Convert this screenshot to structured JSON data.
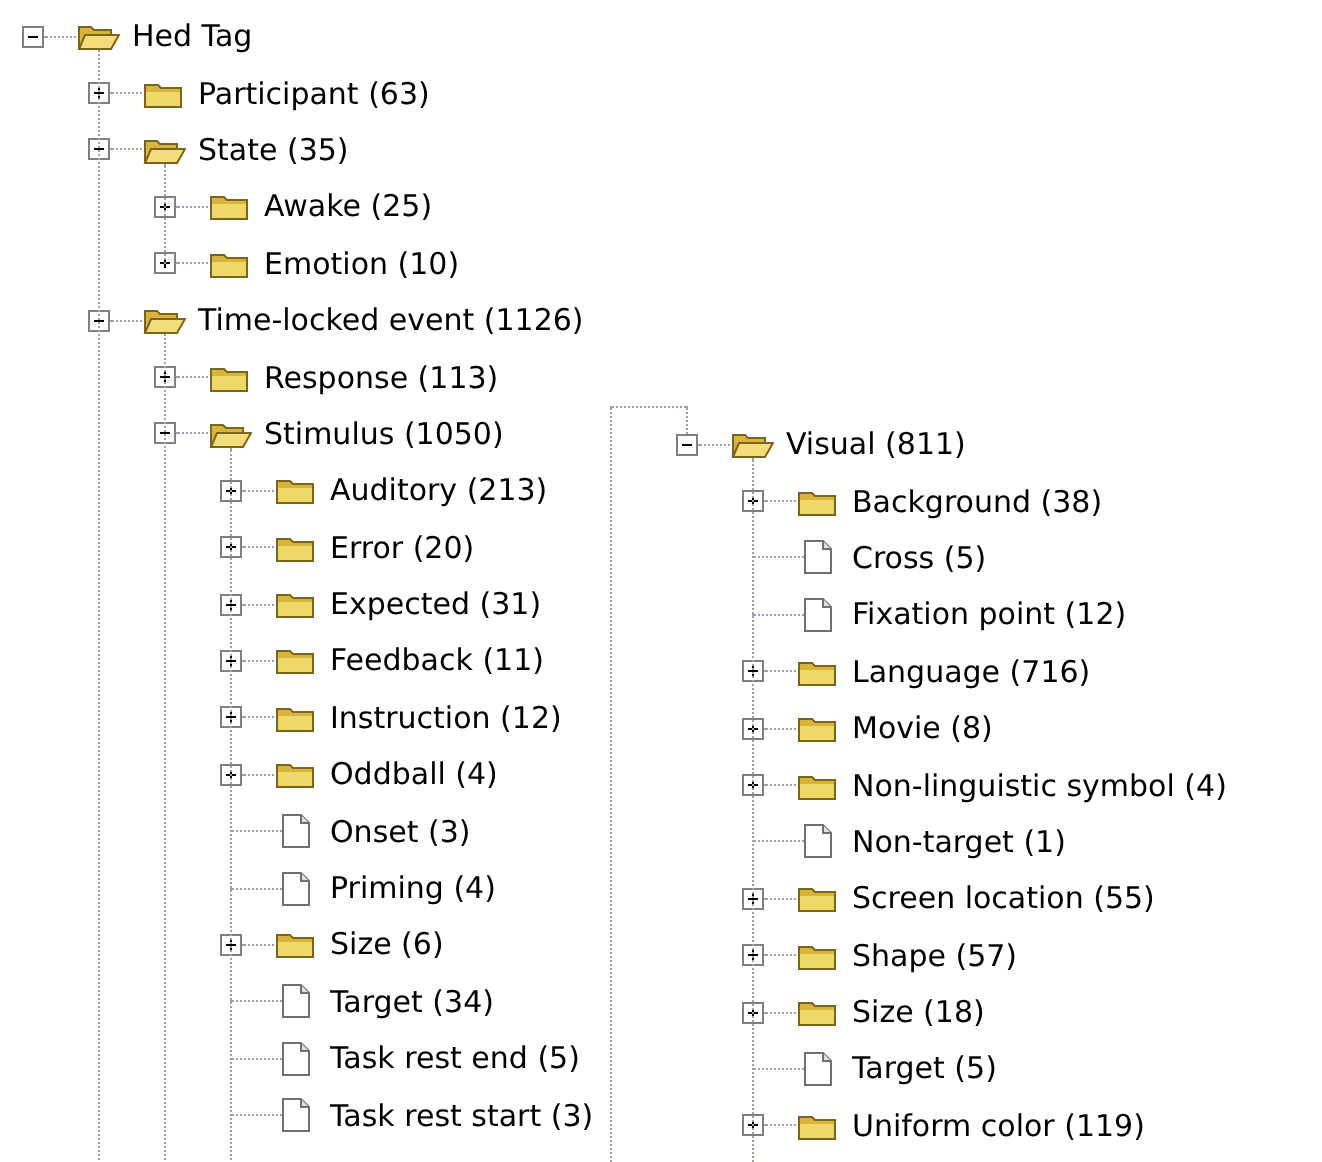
{
  "tree": {
    "label": "Hed Tag",
    "kind": "folder",
    "expanded": true,
    "children": [
      {
        "label": "Participant (63)",
        "kind": "folder",
        "expanded": false
      },
      {
        "label": "State (35)",
        "kind": "folder",
        "expanded": true,
        "children": [
          {
            "label": "Awake (25)",
            "kind": "folder",
            "expanded": false
          },
          {
            "label": "Emotion (10)",
            "kind": "folder",
            "expanded": false
          }
        ]
      },
      {
        "label": "Time-locked event (1126)",
        "kind": "folder",
        "expanded": true,
        "children": [
          {
            "label": "Response (113)",
            "kind": "folder",
            "expanded": false
          },
          {
            "label": "Stimulus (1050)",
            "kind": "folder",
            "expanded": true,
            "children": [
              {
                "label": "Auditory (213)",
                "kind": "folder",
                "expanded": false
              },
              {
                "label": "Error (20)",
                "kind": "folder",
                "expanded": false
              },
              {
                "label": "Expected (31)",
                "kind": "folder",
                "expanded": false
              },
              {
                "label": "Feedback (11)",
                "kind": "folder",
                "expanded": false
              },
              {
                "label": "Instruction (12)",
                "kind": "folder",
                "expanded": false
              },
              {
                "label": "Oddball (4)",
                "kind": "folder",
                "expanded": false
              },
              {
                "label": "Onset (3)",
                "kind": "leaf"
              },
              {
                "label": "Priming (4)",
                "kind": "leaf"
              },
              {
                "label": "Size (6)",
                "kind": "folder",
                "expanded": false
              },
              {
                "label": "Target (34)",
                "kind": "leaf"
              },
              {
                "label": "Task rest end (5)",
                "kind": "leaf"
              },
              {
                "label": "Task rest start (3)",
                "kind": "leaf"
              }
            ]
          }
        ]
      }
    ]
  },
  "continuation": {
    "label": "Visual (811)",
    "kind": "folder",
    "expanded": true,
    "children": [
      {
        "label": "Background (38)",
        "kind": "folder",
        "expanded": false
      },
      {
        "label": "Cross (5)",
        "kind": "leaf"
      },
      {
        "label": "Fixation point (12)",
        "kind": "leaf"
      },
      {
        "label": "Language (716)",
        "kind": "folder",
        "expanded": false
      },
      {
        "label": "Movie (8)",
        "kind": "folder",
        "expanded": false
      },
      {
        "label": "Non-linguistic symbol (4)",
        "kind": "folder",
        "expanded": false
      },
      {
        "label": "Non-target (1)",
        "kind": "leaf"
      },
      {
        "label": "Screen location (55)",
        "kind": "folder",
        "expanded": false
      },
      {
        "label": "Shape (57)",
        "kind": "folder",
        "expanded": false
      },
      {
        "label": "Size (18)",
        "kind": "folder",
        "expanded": false
      },
      {
        "label": "Target (5)",
        "kind": "leaf"
      },
      {
        "label": "Uniform color (119)",
        "kind": "folder",
        "expanded": false
      }
    ]
  }
}
